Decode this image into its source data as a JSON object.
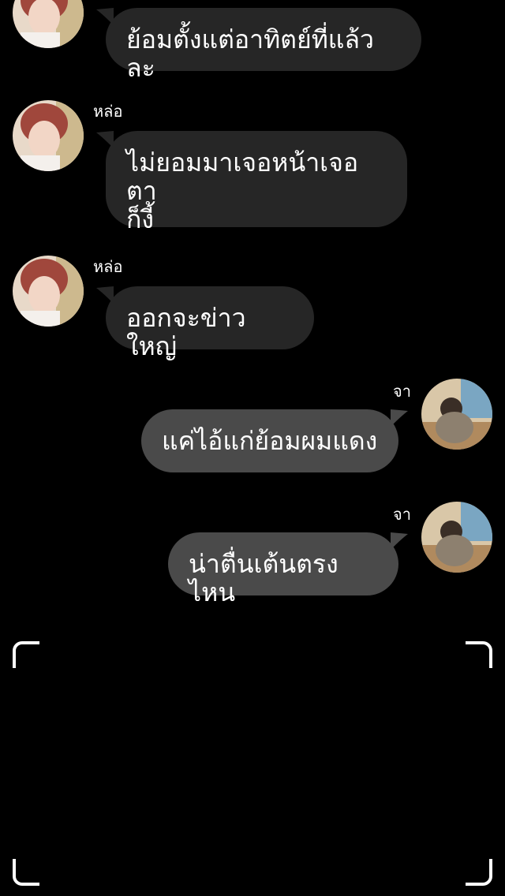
{
  "colors": {
    "background": "#000000",
    "incoming_bubble": "#262626",
    "outgoing_bubble": "#4a4a4a",
    "text": "#ffffff"
  },
  "messages": [
    {
      "direction": "incoming",
      "sender": "",
      "text": "ย้อมตั้งแต่อาทิตย์ที่แล้วละ",
      "avatar": "avatar-red-hair-icon"
    },
    {
      "direction": "incoming",
      "sender": "หล่อ",
      "text": "ไม่ยอมมาเจอหน้าเจอตา\nก็งี้",
      "avatar": "avatar-red-hair-icon"
    },
    {
      "direction": "incoming",
      "sender": "หล่อ",
      "text": "ออกจะข่าว ใหญ่",
      "avatar": "avatar-red-hair-icon"
    },
    {
      "direction": "outgoing",
      "sender": "จา",
      "text": "แค่ไอ้แก่ย้อมผมแดง",
      "avatar": "avatar-cafe-icon"
    },
    {
      "direction": "outgoing",
      "sender": "จา",
      "text": "น่าตื่นเต้นตรงไหน",
      "avatar": "avatar-cafe-icon"
    }
  ],
  "viewfinder": {
    "corners": [
      "top-left",
      "top-right",
      "bottom-left",
      "bottom-right"
    ],
    "icon": "viewfinder-corner-icon"
  }
}
